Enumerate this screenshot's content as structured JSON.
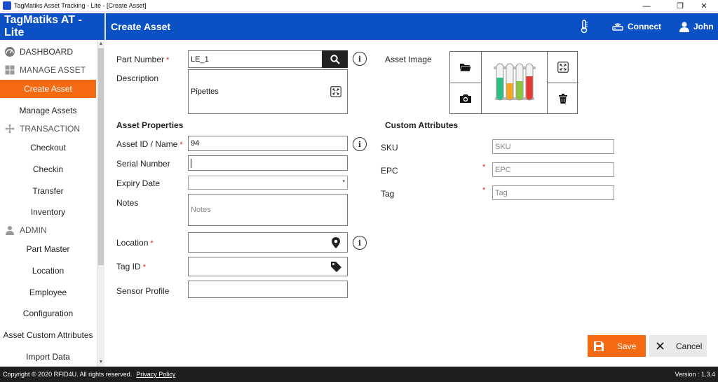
{
  "window": {
    "title": "TagMatiks Asset Tracking - Lite - [Create Asset]",
    "controls": {
      "minimize": "—",
      "restore": "❐",
      "close": "✕"
    }
  },
  "header": {
    "brand": "TagMatiks AT - Lite",
    "page_title": "Create Asset",
    "connect_label": "Connect",
    "user_label": "John"
  },
  "sidebar": {
    "dashboard": "DASHBOARD",
    "manage_asset": "MANAGE ASSET",
    "create_asset": "Create Asset",
    "manage_assets": "Manage Assets",
    "transaction": "TRANSACTION",
    "checkout": "Checkout",
    "checkin": "Checkin",
    "transfer": "Transfer",
    "inventory": "Inventory",
    "admin": "ADMIN",
    "part_master": "Part Master",
    "location": "Location",
    "employee": "Employee",
    "configuration": "Configuration",
    "asset_custom_attributes": "Asset Custom Attributes",
    "import_data": "Import Data"
  },
  "form": {
    "part_number": {
      "label": "Part Number",
      "value": "LE_1"
    },
    "description": {
      "label": "Description",
      "value": "Pipettes"
    },
    "asset_image": {
      "label": "Asset Image"
    },
    "asset_properties_title": "Asset Properties",
    "asset_id": {
      "label": "Asset ID / Name",
      "value": "94"
    },
    "serial_number": {
      "label": "Serial Number",
      "value": ""
    },
    "expiry_date": {
      "label": "Expiry Date",
      "value": ""
    },
    "notes": {
      "label": "Notes",
      "placeholder": "Notes"
    },
    "location": {
      "label": "Location",
      "value": ""
    },
    "tag_id": {
      "label": "Tag ID",
      "value": ""
    },
    "sensor_profile": {
      "label": "Sensor Profile",
      "value": ""
    },
    "custom_attributes_title": "Custom Attributes",
    "sku": {
      "label": "SKU",
      "placeholder": "SKU"
    },
    "epc": {
      "label": "EPC",
      "placeholder": "EPC"
    },
    "tag": {
      "label": "Tag",
      "placeholder": "Tag"
    },
    "required_marker": "*",
    "info_glyph": "i"
  },
  "buttons": {
    "save": "Save",
    "cancel": "Cancel"
  },
  "footer": {
    "copyright": "Copyright © 2020 RFID4U. All rights reserved.",
    "privacy": "Privacy Policy",
    "version": "Version : 1.3.4"
  },
  "colors": {
    "header_blue": "#0b51c5",
    "accent_orange": "#f36a12",
    "footer_dark": "#1e1e1e"
  },
  "icons": {
    "thermometer": "thermometer-icon",
    "connect": "router-icon",
    "user": "user-icon",
    "search": "search-icon",
    "location": "map-pin-icon",
    "tag": "tag-icon",
    "folder": "folder-icon",
    "camera": "camera-icon",
    "expand": "expand-icon",
    "delete": "trash-icon"
  }
}
